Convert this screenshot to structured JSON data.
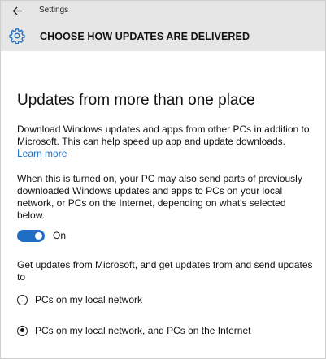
{
  "window": {
    "title": "Settings"
  },
  "header": {
    "title": "CHOOSE HOW UPDATES ARE DELIVERED",
    "icon": "gear-icon",
    "back_icon": "back-arrow-icon"
  },
  "main": {
    "section_title": "Updates from more than one place",
    "intro_text": "Download Windows updates and apps from other PCs in addition to Microsoft. This can help speed up app and update downloads.",
    "learn_more_label": "Learn more",
    "details_text": "When this is turned on, your PC may also send parts of previously downloaded Windows updates and apps to PCs on your local network, or PCs on the Internet, depending on what's selected below.",
    "toggle": {
      "state": "on",
      "label": "On"
    },
    "get_updates_text": "Get updates from Microsoft, and get updates from and send updates to",
    "options": [
      {
        "label": "PCs on my local network",
        "selected": false
      },
      {
        "label": "PCs on my local network, and PCs on the Internet",
        "selected": true
      }
    ]
  },
  "colors": {
    "accent": "#1f6ec4",
    "header_bg": "#e6e6e6",
    "text": "#111111"
  }
}
